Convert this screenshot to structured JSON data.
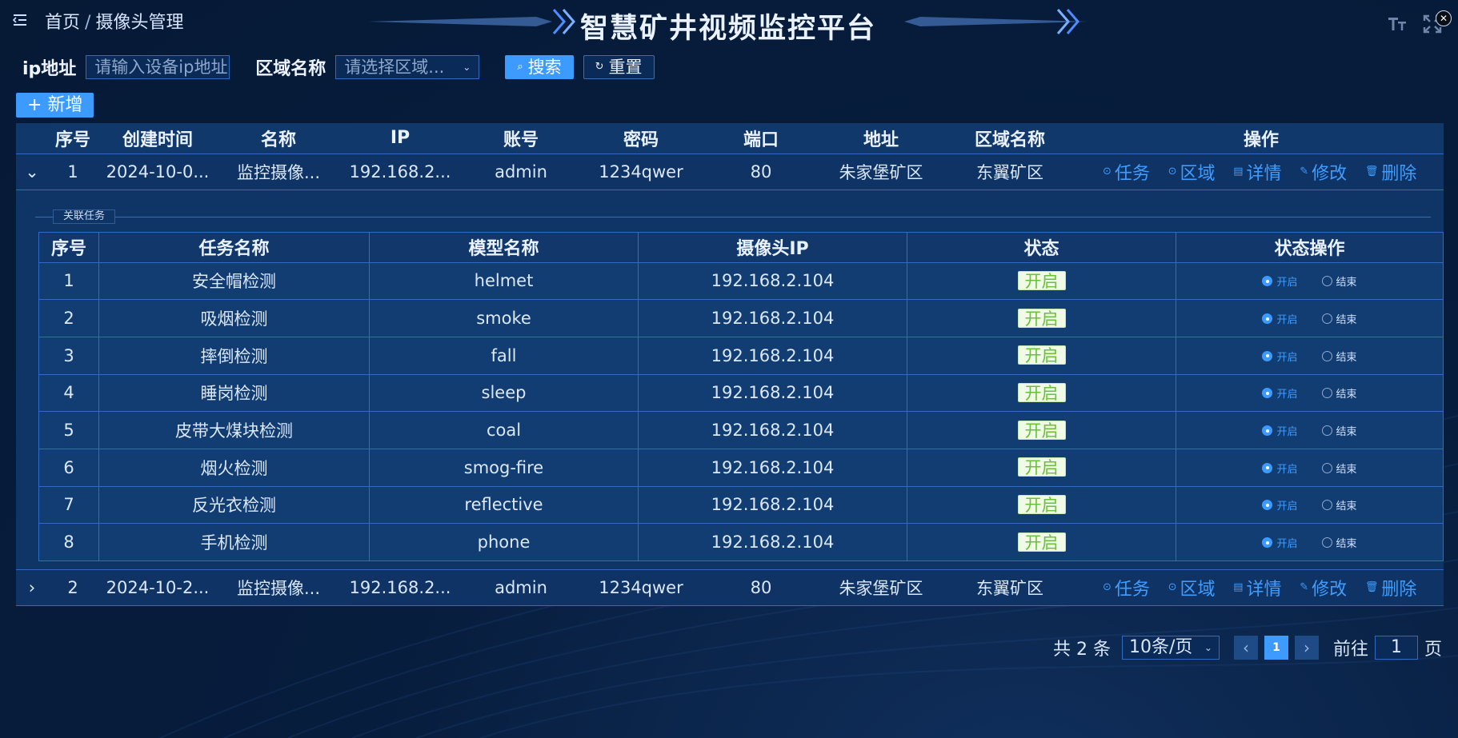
{
  "breadcrumb": {
    "home": "首页",
    "sep": "/",
    "current": "摄像头管理"
  },
  "title": "智慧矿井视频监控平台",
  "filters": {
    "ip_label": "ip地址",
    "ip_placeholder": "请输入设备ip地址",
    "area_label": "区域名称",
    "area_placeholder": "请选择区域...",
    "search": "搜索",
    "reset": "重置"
  },
  "add_button": "新增",
  "table": {
    "headers": [
      "序号",
      "创建时间",
      "名称",
      "IP",
      "账号",
      "密码",
      "端口",
      "地址",
      "区域名称",
      "操作"
    ],
    "rows": [
      {
        "index": "1",
        "created": "2024-10-0...",
        "name": "监控摄像...",
        "ip": "192.168.2...",
        "account": "admin",
        "password": "1234qwer",
        "port": "80",
        "address": "朱家堡矿区",
        "area": "东翼矿区",
        "expander": "⌄"
      },
      {
        "index": "2",
        "created": "2024-10-2...",
        "name": "监控摄像...",
        "ip": "192.168.2...",
        "account": "admin",
        "password": "1234qwer",
        "port": "80",
        "address": "朱家堡矿区",
        "area": "东翼矿区",
        "expander": "›"
      }
    ],
    "ops": [
      "任务",
      "区域",
      "详情",
      "修改",
      "删除"
    ]
  },
  "related": {
    "title": "关联任务",
    "headers": [
      "序号",
      "任务名称",
      "模型名称",
      "摄像头IP",
      "状态",
      "状态操作"
    ],
    "rows": [
      {
        "index": "1",
        "task": "安全帽检测",
        "model": "helmet",
        "ip": "192.168.2.104",
        "status": "开启"
      },
      {
        "index": "2",
        "task": "吸烟检测",
        "model": "smoke",
        "ip": "192.168.2.104",
        "status": "开启"
      },
      {
        "index": "3",
        "task": "摔倒检测",
        "model": "fall",
        "ip": "192.168.2.104",
        "status": "开启"
      },
      {
        "index": "4",
        "task": "睡岗检测",
        "model": "sleep",
        "ip": "192.168.2.104",
        "status": "开启"
      },
      {
        "index": "5",
        "task": "皮带大煤块检测",
        "model": "coal",
        "ip": "192.168.2.104",
        "status": "开启"
      },
      {
        "index": "6",
        "task": "烟火检测",
        "model": "smog-fire",
        "ip": "192.168.2.104",
        "status": "开启"
      },
      {
        "index": "7",
        "task": "反光衣检测",
        "model": "reflective",
        "ip": "192.168.2.104",
        "status": "开启"
      },
      {
        "index": "8",
        "task": "手机检测",
        "model": "phone",
        "ip": "192.168.2.104",
        "status": "开启"
      }
    ],
    "radio_on": "开启",
    "radio_off": "结束"
  },
  "pagination": {
    "total": "共 2 条",
    "page_size": "10条/页",
    "current": "1",
    "goto_label": "前往",
    "goto_value": "1",
    "page_unit": "页"
  },
  "colors": {
    "accent": "#3d9bff",
    "status_green": "#67c23a"
  }
}
